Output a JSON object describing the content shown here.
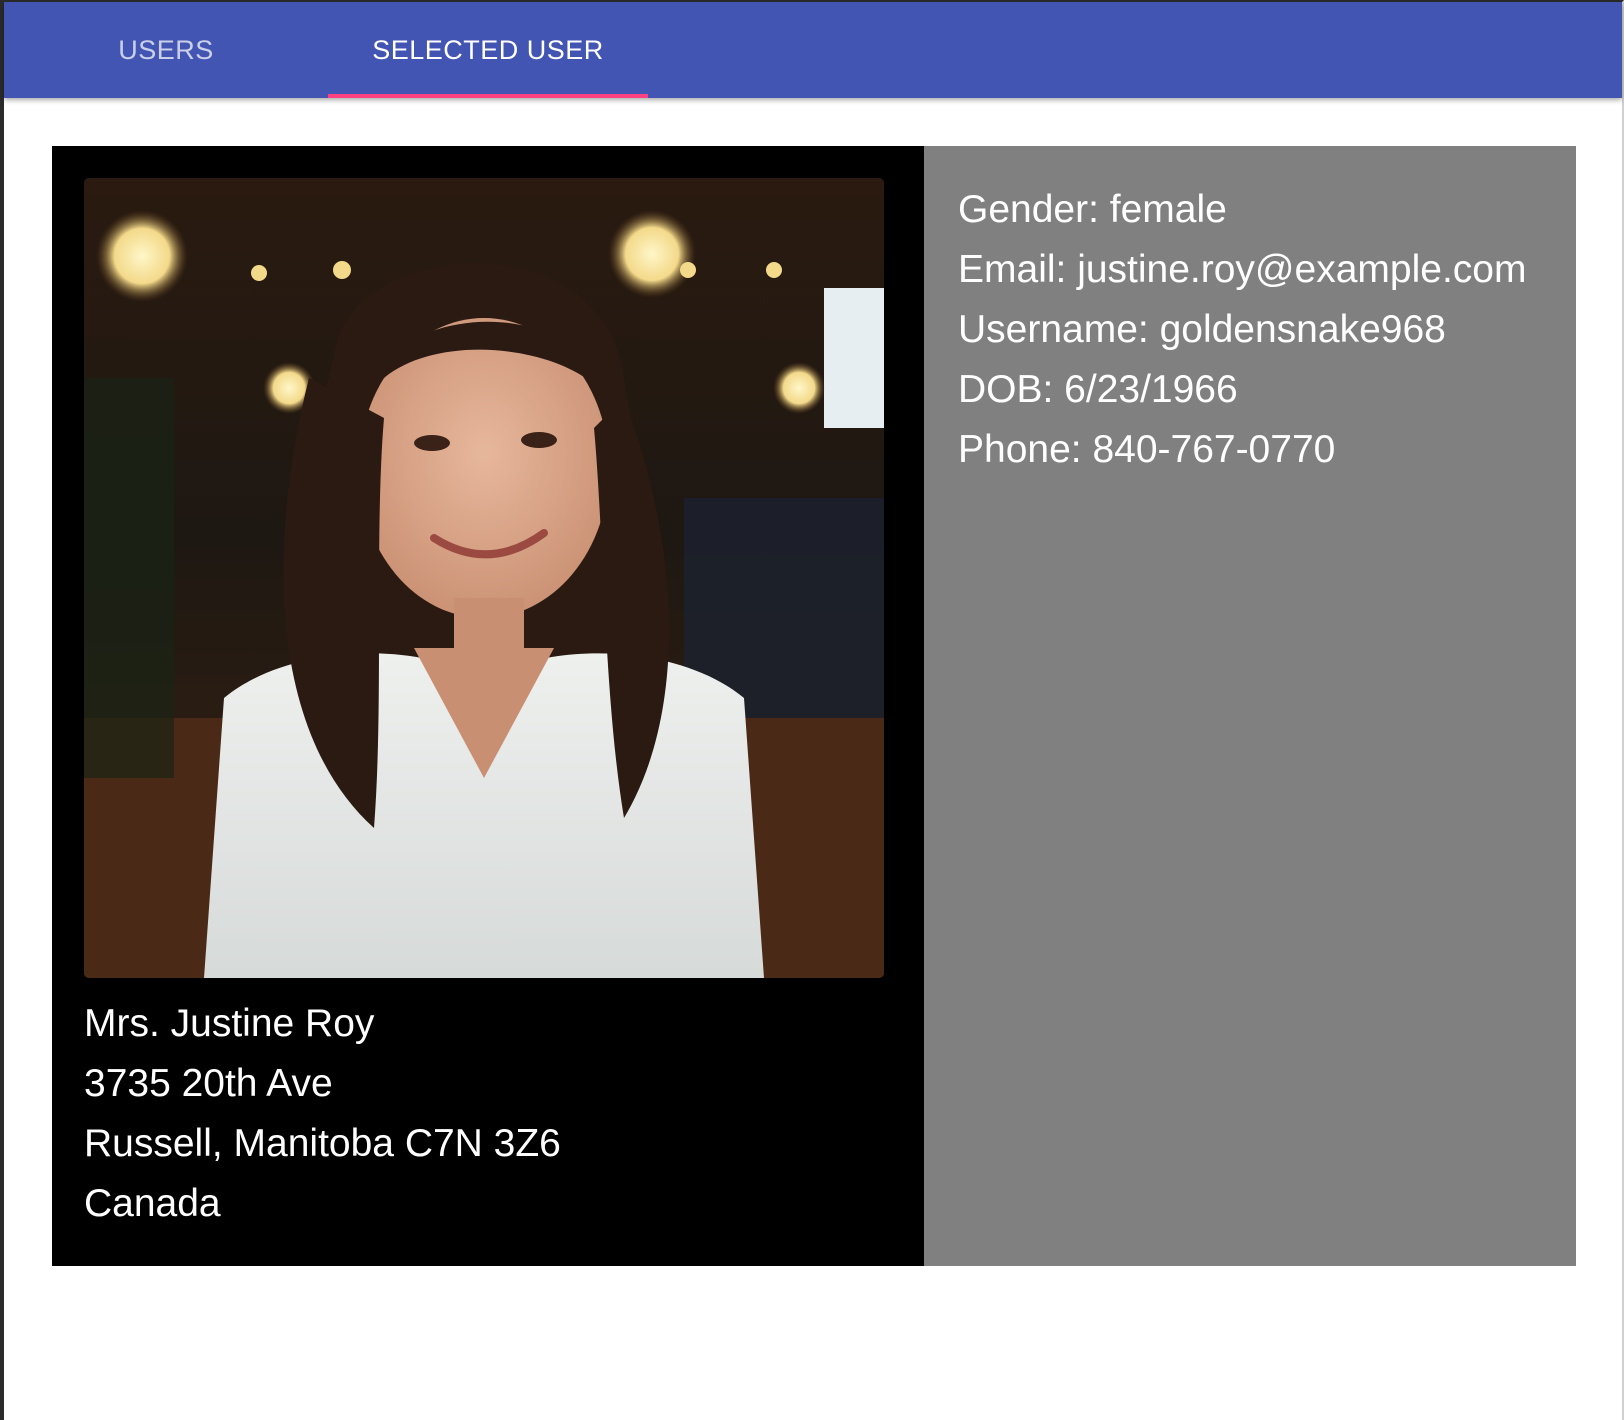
{
  "tabs": [
    {
      "label": "USERS",
      "selected": false
    },
    {
      "label": "SELECTED USER",
      "selected": true
    }
  ],
  "colors": {
    "app_bar": "#4355b3",
    "tab_indicator": "#ff4081",
    "left_panel": "#000000",
    "right_panel": "#808080",
    "text": "#ffffff"
  },
  "user": {
    "name": "Mrs. Justine Roy",
    "street": "3735 20th Ave",
    "city_line": "Russell, Manitoba C7N 3Z6",
    "country": "Canada",
    "gender_line": "Gender: female",
    "email_line": "Email: justine.roy@example.com",
    "username_line": "Username: goldensnake968",
    "dob_line": "DOB: 6/23/1966",
    "phone_line": "Phone: 840-767-0770",
    "photo_icon": "user-photo"
  }
}
